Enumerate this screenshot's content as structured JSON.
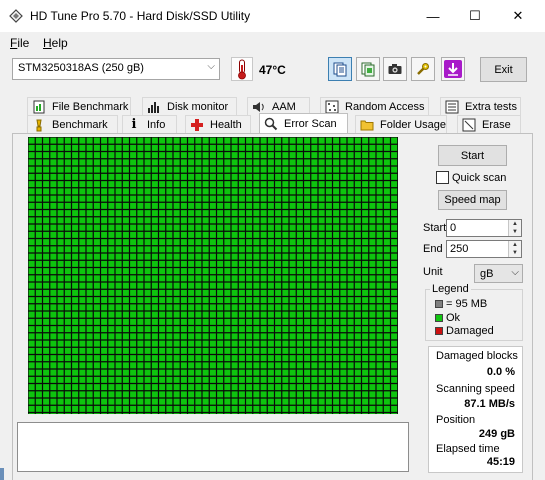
{
  "window": {
    "title": "HD Tune Pro 5.70 - Hard Disk/SSD Utility",
    "controls": {
      "minimize": "—",
      "maximize": "☐",
      "close": "✕"
    }
  },
  "menu": {
    "file_prefix": "F",
    "file_rest": "ile",
    "help_prefix": "H",
    "help_rest": "elp"
  },
  "toolbar": {
    "drive": "STM3250318AS (250 gB)",
    "temperature": "47°C",
    "exit_label": "Exit"
  },
  "tabs_row1": [
    {
      "label": "File Benchmark",
      "icon": "file-benchmark-icon"
    },
    {
      "label": "Disk monitor",
      "icon": "disk-monitor-icon"
    },
    {
      "label": "AAM",
      "icon": "speaker-icon"
    },
    {
      "label": "Random Access",
      "icon": "random-access-icon"
    },
    {
      "label": "Extra tests",
      "icon": "extra-tests-icon"
    }
  ],
  "tabs_row2": [
    {
      "label": "Benchmark",
      "icon": "benchmark-icon"
    },
    {
      "label": "Info",
      "icon": "info-icon"
    },
    {
      "label": "Health",
      "icon": "health-icon"
    },
    {
      "label": "Error Scan",
      "icon": "magnifier-icon"
    },
    {
      "label": "Folder Usage",
      "icon": "folder-icon"
    },
    {
      "label": "Erase",
      "icon": "erase-icon"
    }
  ],
  "controls": {
    "start_label": "Start",
    "quick_scan_label": "Quick scan",
    "quick_scan_checked": false,
    "speed_map_label": "Speed map",
    "start_field_label": "Start",
    "start_value": "0",
    "end_field_label": "End",
    "end_value": "250",
    "unit_label": "Unit",
    "unit_value": "gB"
  },
  "legend": {
    "title": "Legend",
    "items": [
      {
        "label": "= 95 MB",
        "color": "#808080"
      },
      {
        "label": "Ok",
        "color": "#11c611"
      },
      {
        "label": "Damaged",
        "color": "#cc1111"
      }
    ]
  },
  "stats": {
    "damaged_blocks_label": "Damaged blocks",
    "damaged_blocks_value": "0.0 %",
    "scanning_speed_label": "Scanning speed",
    "scanning_speed_value": "87.1 MB/s",
    "position_label": "Position",
    "position_value": "249 gB",
    "elapsed_label": "Elapsed time",
    "elapsed_value": "45:19"
  },
  "scan_grid": {
    "block_color": "#0ec40e",
    "grid_line_color": "#0a0a0a",
    "state": "all-ok"
  }
}
